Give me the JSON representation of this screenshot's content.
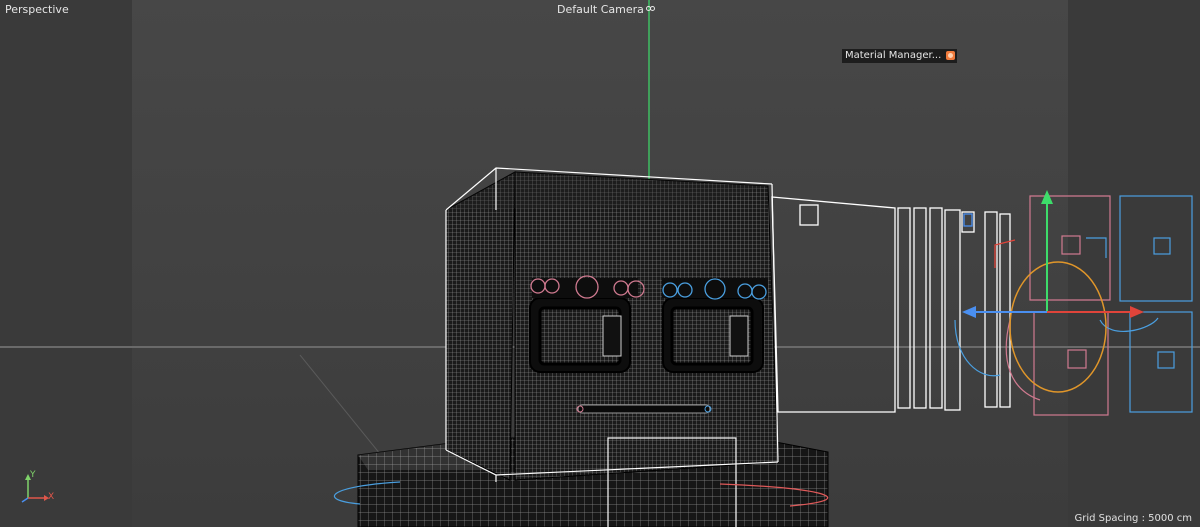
{
  "viewport": {
    "view_name": "Perspective",
    "camera": "Default Camera",
    "grid_spacing": "Grid Spacing : 5000 cm"
  },
  "object_tag": {
    "label": "Material Manager..."
  },
  "axis_gizmo": {
    "y_label": "Y",
    "x_label": "X"
  },
  "colors": {
    "background_center": "#4a4a4a",
    "background_sides": "#3a3a3a",
    "horizon": "#6a6a6a",
    "green_axis": "#3ddc6a",
    "red_axis": "#e0443a",
    "blue_axis": "#4a8ff0",
    "pink_control": "#d07a90",
    "blue_control": "#4a9fe0",
    "orange_control": "#e0962a",
    "selection": "#ffffff"
  }
}
